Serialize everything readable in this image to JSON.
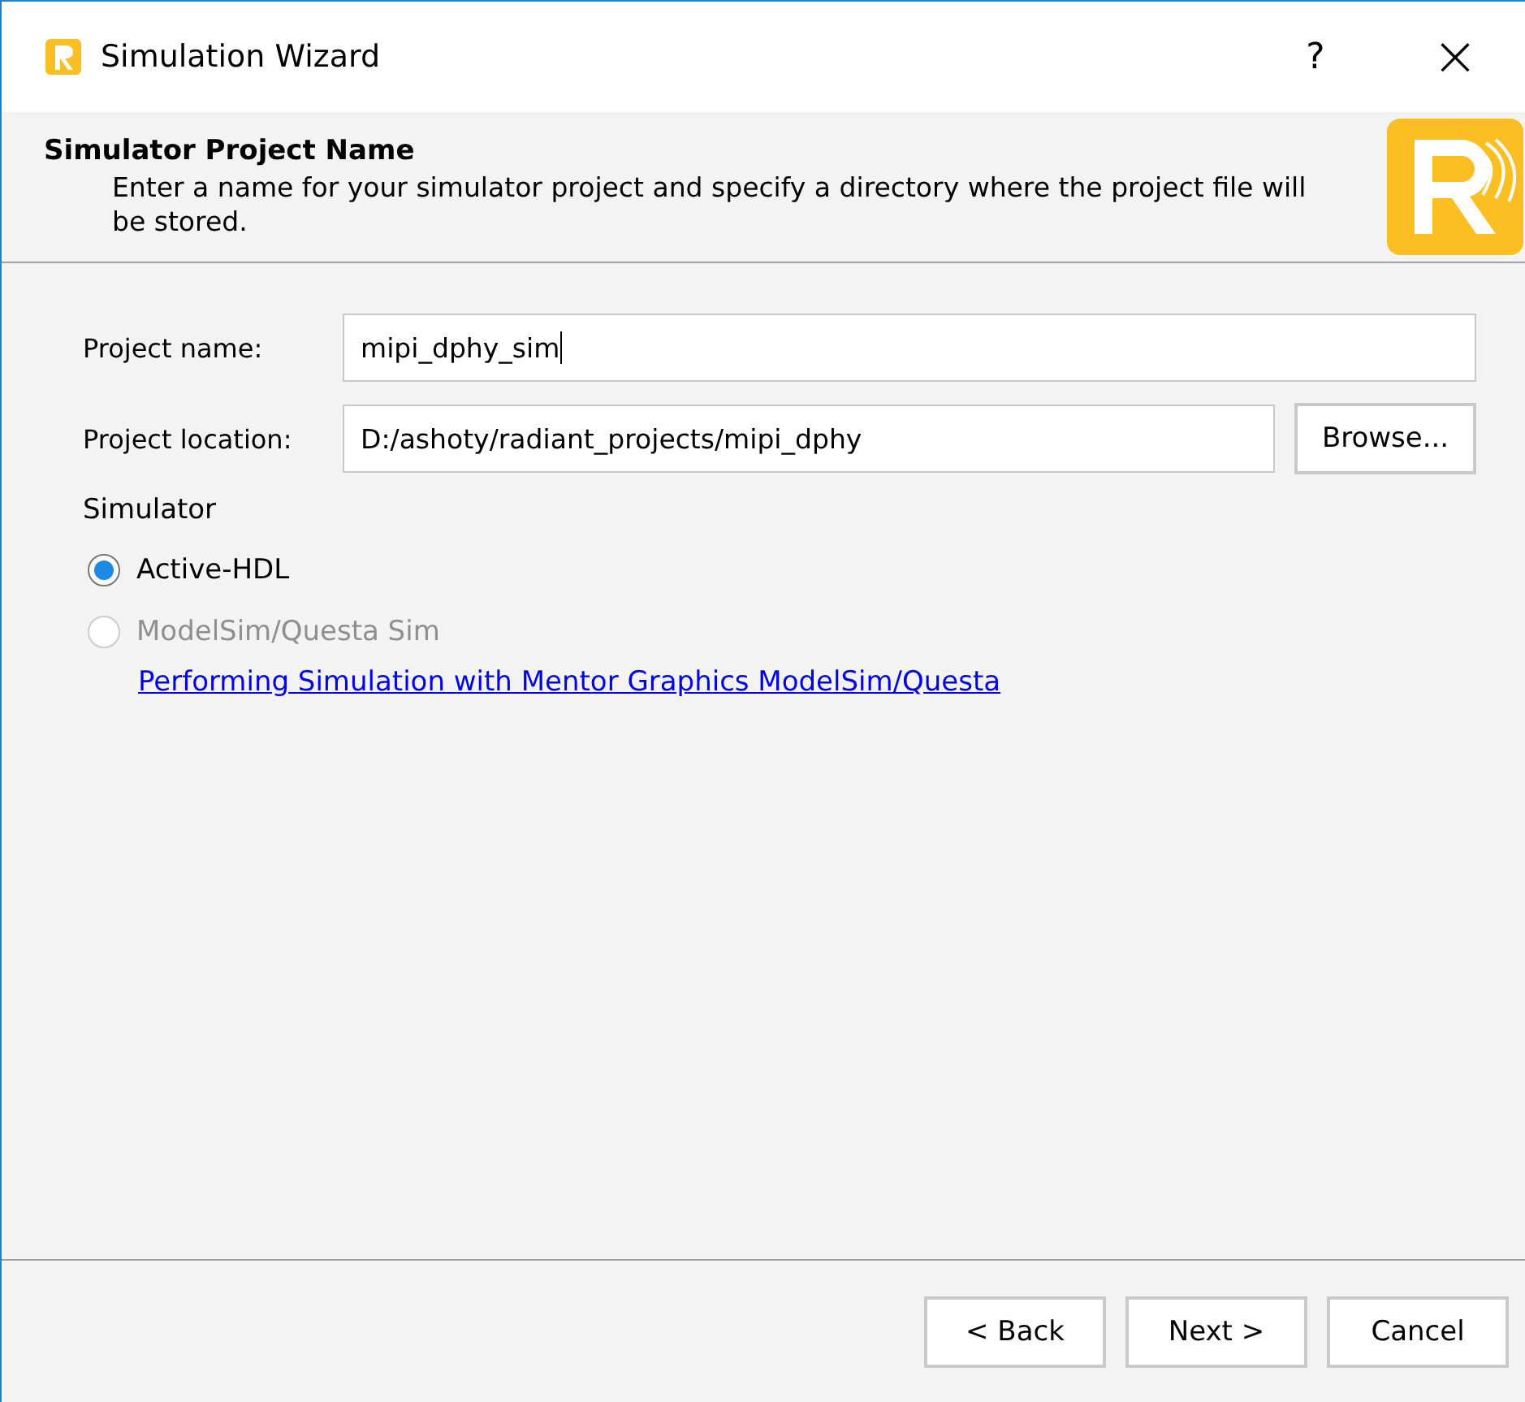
{
  "window": {
    "title": "Simulation Wizard",
    "help": "?",
    "close": "×"
  },
  "header": {
    "title": "Simulator Project Name",
    "description": "Enter a name for your simulator project and specify a directory where the project file will be stored."
  },
  "fields": [
    {
      "label": "Project name:",
      "value": "mipi_dphy_sim",
      "focused": true
    },
    {
      "label": "Project location:",
      "value": "D:/ashoty/radiant_projects/mipi_dphy",
      "button": "Browse..."
    }
  ],
  "simulator": {
    "label": "Simulator",
    "options": [
      {
        "label": "Active-HDL",
        "selected": true,
        "disabled": false
      },
      {
        "label": "ModelSim/Questa Sim",
        "selected": false,
        "disabled": true
      }
    ],
    "link": "Performing Simulation with Mentor Graphics ModelSim/Questa"
  },
  "buttons": [
    "< Back",
    "Next >",
    "Cancel"
  ]
}
